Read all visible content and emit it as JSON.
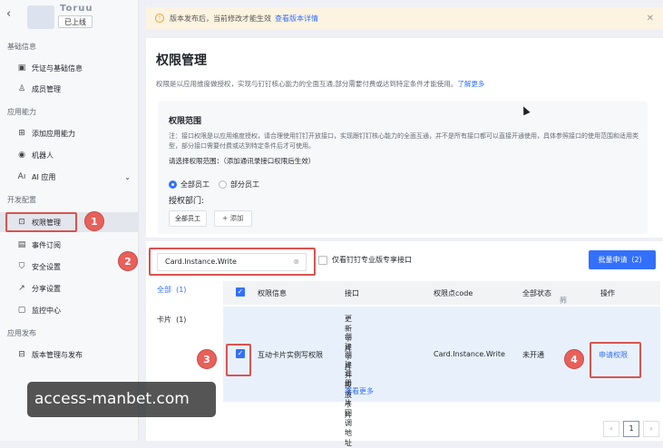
{
  "app": {
    "back_icon": "chevron-left-icon",
    "name": "Toruu",
    "status": "已上线"
  },
  "sidebar": {
    "groups": {
      "basic": "基础信息",
      "ability": "应用能力",
      "dev": "开发配置",
      "publish": "应用发布"
    },
    "items": [
      {
        "label": "凭证与基础信息",
        "icon": "credential-icon"
      },
      {
        "label": "成员管理",
        "icon": "person-icon"
      },
      {
        "label": "添加应用能力",
        "icon": "grid-add-icon"
      },
      {
        "label": "机器人",
        "icon": "robot-icon"
      },
      {
        "label": "AI 应用",
        "icon": "ai-icon"
      },
      {
        "label": "权限管理",
        "icon": "lock-icon"
      },
      {
        "label": "事件订阅",
        "icon": "event-icon"
      },
      {
        "label": "安全设置",
        "icon": "shield-icon"
      },
      {
        "label": "分享设置",
        "icon": "share-icon"
      },
      {
        "label": "监控中心",
        "icon": "monitor-icon"
      },
      {
        "label": "版本管理与发布",
        "icon": "version-icon"
      }
    ]
  },
  "notice": {
    "text": "版本发布后，当前修改才能生效",
    "link": "查看版本详情"
  },
  "page": {
    "title": "权限管理",
    "desc": "权限是以应用维度做授权，实现与钉钉核心能力的全面互通,部分需要付费或达到特定条件才能使用。",
    "desc_link": "了解更多"
  },
  "scope": {
    "title": "权限范围",
    "note": "注：接口权限是以应用维度授权，请合理使用钉钉开放接口，实现跟钉钉核心能力的全面互通，并不是所有接口都可以直接开通使用，具体参照接口的使用范围和适用类型，部分接口需要付费或达到特定条件后才可使用。",
    "ask": "请选择权限范围：（添加通讯录接口权限后生效）",
    "option_all": "全部员工",
    "option_part": "部分员工",
    "dept_label": "授权部门:",
    "dept_chip": "全部员工",
    "add_label": "+ 添加"
  },
  "filter": {
    "search_value": "Card.Instance.Write",
    "only_pro": "仅看钉钉专业版专享接口",
    "bulk_apply": "批量申请（2）"
  },
  "categories": [
    {
      "label": "全部",
      "count": "(1)"
    },
    {
      "label": "卡片",
      "count": "(1)"
    }
  ],
  "table": {
    "headers": {
      "info": "权限信息",
      "api": "接口",
      "code": "权限点code",
      "status": "全部状态",
      "status_filter": "筛选",
      "op": "操作"
    },
    "row": {
      "name": "互动卡片实例写权限",
      "apis": [
        "更新卡片",
        "创建卡片",
        "创建并投放卡片",
        "注册卡片回调地址"
      ],
      "more": "查看更多",
      "code": "Card.Instance.Write",
      "status": "未开通",
      "action": "申请权限"
    }
  },
  "pager": {
    "page": "1"
  },
  "markers": [
    "1",
    "2",
    "3",
    "4"
  ],
  "watermark": "access-manbet.com",
  "colors": {
    "accent": "#3370ff",
    "marker": "#e8605a"
  }
}
